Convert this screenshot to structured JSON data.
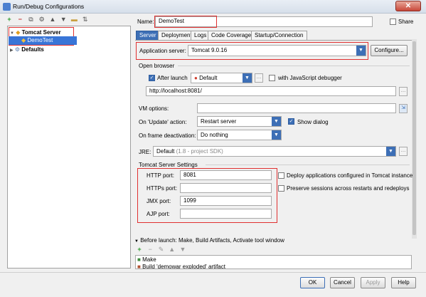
{
  "window": {
    "title": "Run/Debug Configurations",
    "close_label": "✕"
  },
  "toolbar": {
    "icons": [
      "add-icon",
      "remove-icon",
      "copy-icon",
      "wrench-icon",
      "move-up-icon",
      "move-down-icon",
      "folder-icon",
      "sort-icon"
    ]
  },
  "tree": {
    "group_label": "Tomcat Server",
    "item_label": "DemoTest",
    "defaults_label": "Defaults"
  },
  "name": {
    "label": "Name:",
    "value": "DemoTest",
    "share_label": "Share"
  },
  "tabs": [
    {
      "label": "Server",
      "active": true
    },
    {
      "label": "Deployment"
    },
    {
      "label": "Logs"
    },
    {
      "label": "Code Coverage"
    },
    {
      "label": "Startup/Connection"
    }
  ],
  "server": {
    "app_server_label": "Application server:",
    "app_server_value": "Tomcat 9.0.16",
    "configure_label": "Configure...",
    "open_browser_label": "Open browser",
    "after_launch_label": "After launch",
    "browser_value": "Default",
    "js_debugger_label": "with JavaScript debugger",
    "url_value": "http://localhost:8081/",
    "vm_options_label": "VM options:",
    "update_action_label": "On 'Update' action:",
    "update_action_value": "Restart server",
    "show_dialog_label": "Show dialog",
    "frame_deactivation_label": "On frame deactivation:",
    "frame_deactivation_value": "Do nothing",
    "jre_label": "JRE:",
    "jre_value": "Default",
    "jre_hint": "(1.8 - project SDK)",
    "tomcat_settings_label": "Tomcat Server Settings",
    "http_port_label": "HTTP port:",
    "http_port_value": "8081",
    "https_port_label": "HTTPs port:",
    "https_port_value": "",
    "jmx_port_label": "JMX port:",
    "jmx_port_value": "1099",
    "ajp_port_label": "AJP port:",
    "ajp_port_value": "",
    "deploy_apps_label": "Deploy applications configured in Tomcat instance",
    "preserve_sessions_label": "Preserve sessions across restarts and redeploys"
  },
  "before_launch": {
    "label": "Before launch: Make, Build Artifacts, Activate tool window",
    "items": [
      "Make",
      "Build 'demowar exploded' artifact"
    ]
  },
  "buttons": {
    "ok": "OK",
    "cancel": "Cancel",
    "apply": "Apply",
    "help": "Help"
  },
  "colors": {
    "accent": "#3d6fb6",
    "selection": "#3875d7",
    "highlight_box": "#e03030"
  }
}
